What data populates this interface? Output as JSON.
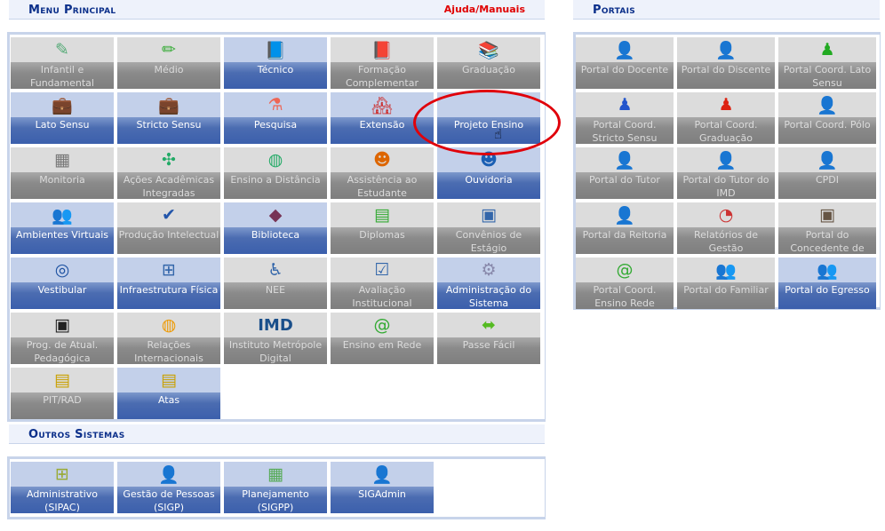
{
  "menu_principal": {
    "title": "Menu Principal",
    "help_link": "Ajuda/Manuais",
    "items": [
      {
        "label": "Infantil e Fundamental",
        "icon": "pencil-cup-icon",
        "active": false
      },
      {
        "label": "Médio",
        "icon": "pencil-icon",
        "active": false
      },
      {
        "label": "Técnico",
        "icon": "blue-book-icon",
        "active": true
      },
      {
        "label": "Formação Complementar",
        "icon": "red-book-icon",
        "active": false
      },
      {
        "label": "Graduação",
        "icon": "book-stack-icon",
        "active": false
      },
      {
        "label": "Lato Sensu",
        "icon": "yellow-briefcase-icon",
        "active": true
      },
      {
        "label": "Stricto Sensu",
        "icon": "gray-briefcase-icon",
        "active": true
      },
      {
        "label": "Pesquisa",
        "icon": "flask-icon",
        "active": true
      },
      {
        "label": "Extensão",
        "icon": "houses-icon",
        "active": true
      },
      {
        "label": "Projeto Ensino",
        "icon": "",
        "active": true
      },
      {
        "label": "Monitoria",
        "icon": "presentation-board-icon",
        "active": false
      },
      {
        "label": "Ações Acadêmicas Integradas",
        "icon": "puzzle-icon",
        "active": false
      },
      {
        "label": "Ensino a Distância",
        "icon": "globe-icon",
        "active": false
      },
      {
        "label": "Assistência ao Estudante",
        "icon": "student-chat-icon",
        "active": false
      },
      {
        "label": "Ouvidoria",
        "icon": "headset-user-icon",
        "active": true
      },
      {
        "label": "Ambientes Virtuais",
        "icon": "users-group-icon",
        "active": true
      },
      {
        "label": "Produção Intelectual",
        "icon": "user-check-icon",
        "active": false
      },
      {
        "label": "Biblioteca",
        "icon": "library-book-icon",
        "active": true
      },
      {
        "label": "Diplomas",
        "icon": "diploma-icon",
        "active": false
      },
      {
        "label": "Convênios de Estágio",
        "icon": "contact-book-icon",
        "active": false
      },
      {
        "label": "Vestibular",
        "icon": "vestibular-logo-icon",
        "active": true
      },
      {
        "label": "Infraestrutura Física",
        "icon": "network-icon",
        "active": true
      },
      {
        "label": "NEE",
        "icon": "wheelchair-icon",
        "active": false
      },
      {
        "label": "Avaliação Institucional",
        "icon": "checked-document-icon",
        "active": false
      },
      {
        "label": "Administração do Sistema",
        "icon": "gear-icon",
        "active": true
      },
      {
        "label": "Prog. de Atual. Pedagógica",
        "icon": "monitor-people-icon",
        "active": false
      },
      {
        "label": "Relações Internacionais",
        "icon": "globe-folder-icon",
        "active": false
      },
      {
        "label": "Instituto Metrópole Digital",
        "icon": "imd-logo-icon",
        "icon_text": "IMD",
        "active": false
      },
      {
        "label": "Ensino em Rede",
        "icon": "brazil-map-at-icon",
        "active": false
      },
      {
        "label": "Passe Fácil",
        "icon": "double-arrow-icon",
        "active": false
      },
      {
        "label": "PIT/RAD",
        "icon": "document-list-icon",
        "active": false
      },
      {
        "label": "Atas",
        "icon": "document-list-icon",
        "active": true
      }
    ]
  },
  "outros_sistemas": {
    "title": "Outros Sistemas",
    "items": [
      {
        "label": "Administrativo (SIPAC)",
        "icon": "admin-network-icon",
        "active": true
      },
      {
        "label": "Gestão de Pessoas (SIGP)",
        "icon": "user-icon",
        "active": true
      },
      {
        "label": "Planejamento (SIGPP)",
        "icon": "planning-chart-icon",
        "active": true
      },
      {
        "label": "SIGAdmin",
        "icon": "admin-user-monitor-icon",
        "active": true
      }
    ]
  },
  "portais": {
    "title": "Portais",
    "items": [
      {
        "label": "Portal do Docente",
        "icon": "teacher-icon",
        "active": false
      },
      {
        "label": "Portal do Discente",
        "icon": "student-green-icon",
        "active": false
      },
      {
        "label": "Portal Coord. Lato Sensu",
        "icon": "green-pawn-icon",
        "active": false
      },
      {
        "label": "Portal Coord. Stricto Sensu",
        "icon": "blue-pawn-icon",
        "active": false
      },
      {
        "label": "Portal Coord. Graduação",
        "icon": "red-pawn-icon",
        "active": false
      },
      {
        "label": "Portal Coord. Pólo",
        "icon": "teacher-icon",
        "active": false
      },
      {
        "label": "Portal do Tutor",
        "icon": "teacher-icon",
        "active": false
      },
      {
        "label": "Portal do Tutor do IMD",
        "icon": "teacher-icon",
        "active": false
      },
      {
        "label": "CPDI",
        "icon": "manager-icon",
        "active": false
      },
      {
        "label": "Portal da Reitoria",
        "icon": "manager-icon",
        "active": false
      },
      {
        "label": "Relatórios de Gestão",
        "icon": "reports-chart-icon",
        "active": false
      },
      {
        "label": "Portal do Concedente de",
        "icon": "id-card-icon",
        "active": false
      },
      {
        "label": "Portal Coord. Ensino Rede",
        "icon": "brazil-map-at-icon",
        "active": false
      },
      {
        "label": "Portal do Familiar",
        "icon": "family-icon",
        "active": false
      },
      {
        "label": "Portal do Egresso",
        "icon": "graduates-icon",
        "active": true
      }
    ]
  },
  "colors": {
    "active_tile": "#3b5fac",
    "inactive_tile": "#7e7e7e",
    "section_title": "#0b2f8a",
    "help_link": "#e00000",
    "annotation": "#e00000"
  }
}
